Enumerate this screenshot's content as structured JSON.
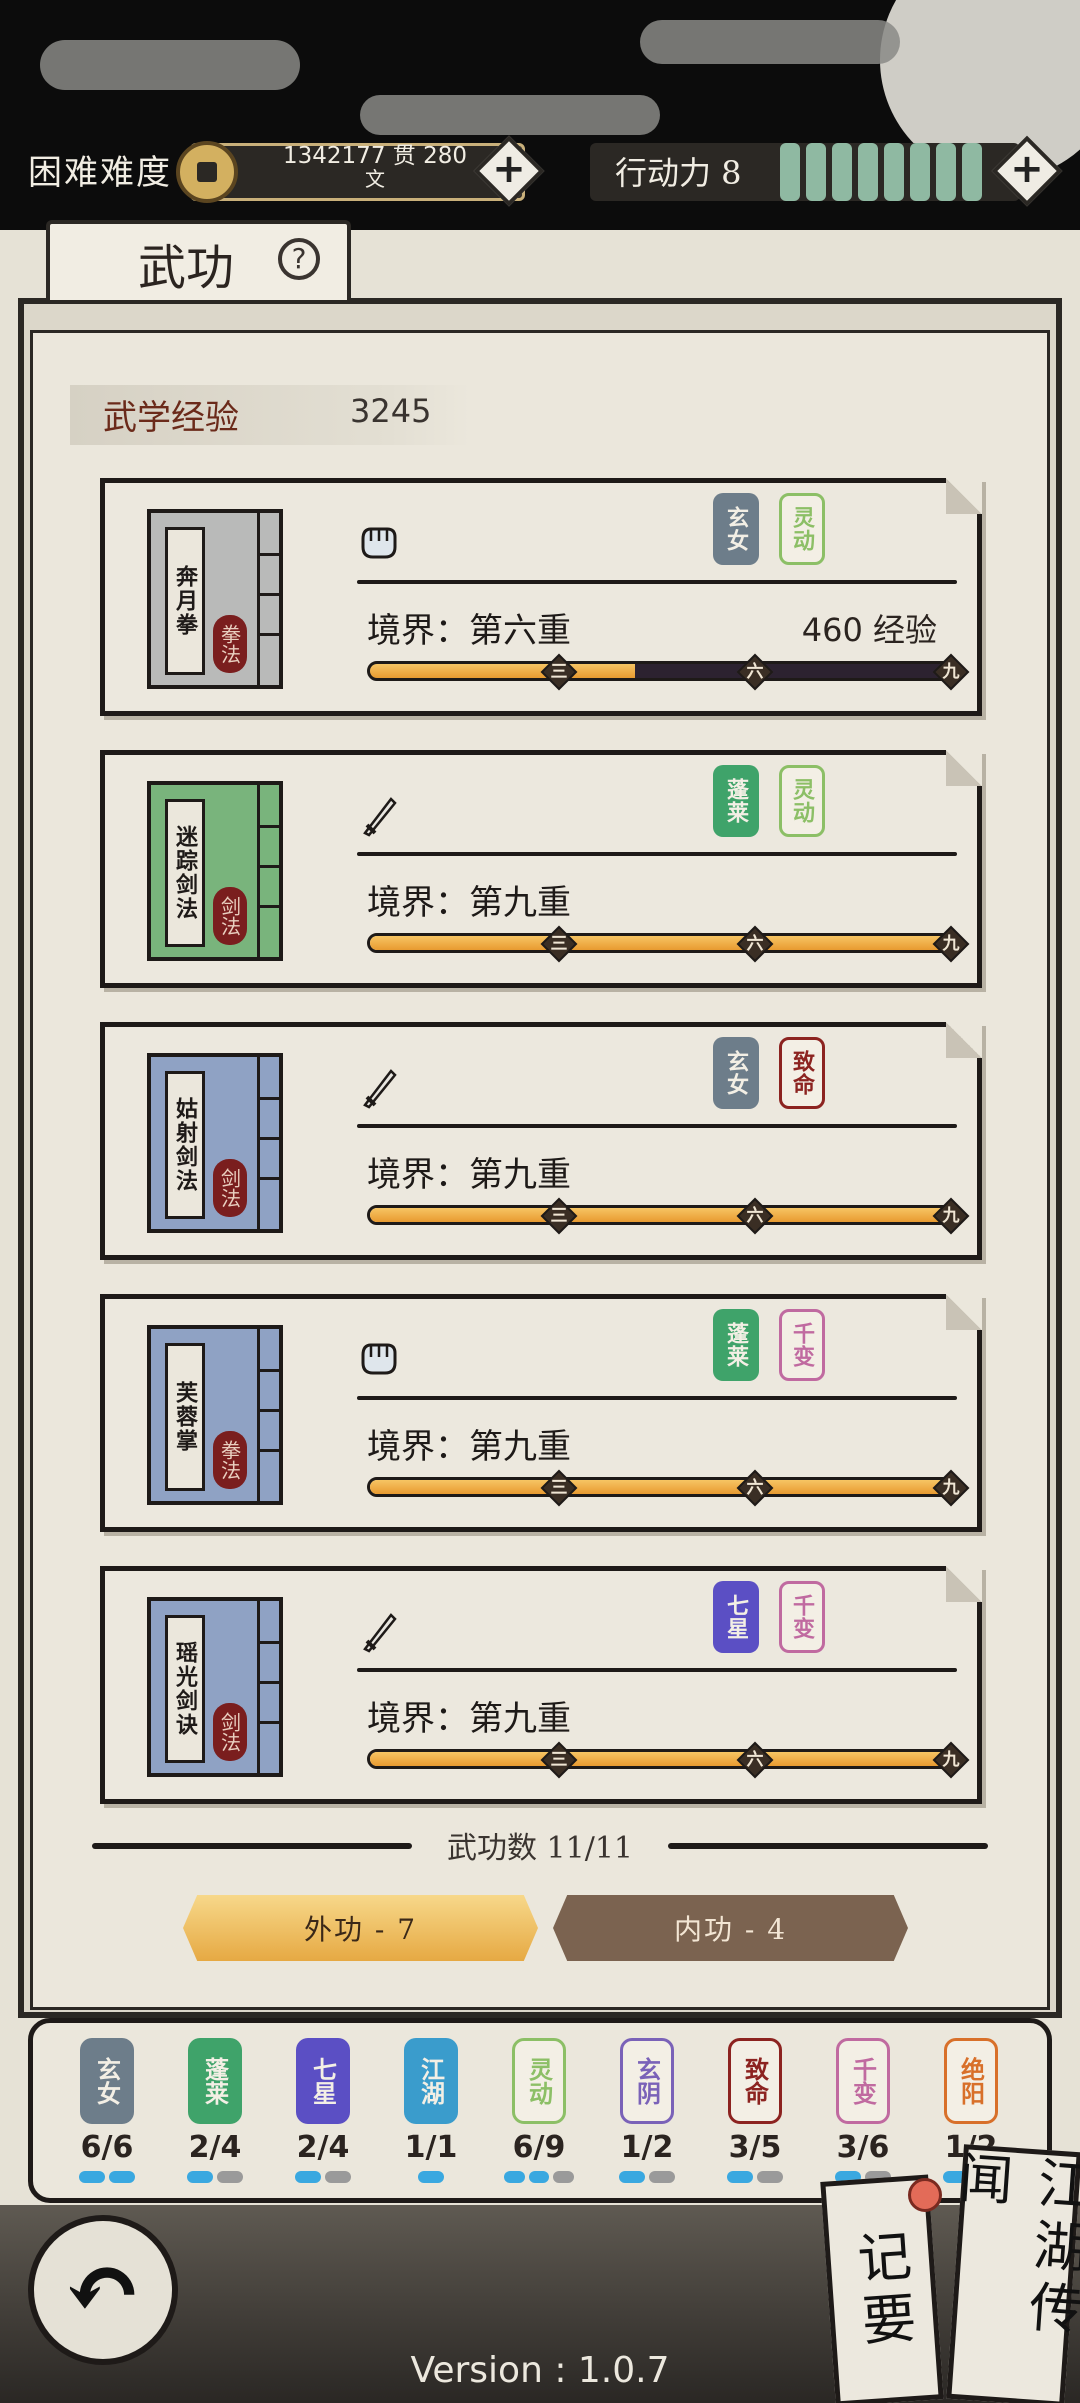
{
  "header": {
    "difficulty": "困难难度",
    "currency_amount": "1342177 贯  280",
    "currency_unit": "文",
    "action_label": "行动力 8",
    "action_pips": 8,
    "add_currency_icon": "plus-icon",
    "add_action_icon": "plus-icon"
  },
  "tab": {
    "title": "武功",
    "help": "?"
  },
  "experience": {
    "label": "武学经验",
    "value": "3245"
  },
  "skills": [
    {
      "name": "奔月拳",
      "category": "拳法",
      "type_icon": "fist-icon",
      "book_color": "#b9bab9",
      "tags": [
        {
          "text": "玄女",
          "color": "#6d7d8a",
          "style": "solid"
        },
        {
          "text": "灵动",
          "color": "#8cbf66",
          "style": "outline"
        }
      ],
      "realm": "境界：第六重",
      "exp_needed": "460 经验",
      "progress": 0.45,
      "markers": [
        "三",
        "六",
        "九"
      ]
    },
    {
      "name": "迷踪剑法",
      "category": "剑法",
      "type_icon": "sword-icon",
      "book_color": "#79b47c",
      "tags": [
        {
          "text": "蓬莱",
          "color": "#3fa36a",
          "style": "solid"
        },
        {
          "text": "灵动",
          "color": "#8cbf66",
          "style": "outline"
        }
      ],
      "realm": "境界：第九重",
      "exp_needed": "",
      "progress": 1.0,
      "markers": [
        "三",
        "六",
        "九"
      ]
    },
    {
      "name": "姑射剑法",
      "category": "剑法",
      "type_icon": "sword-icon",
      "book_color": "#8fa2c4",
      "tags": [
        {
          "text": "玄女",
          "color": "#6d7d8a",
          "style": "solid"
        },
        {
          "text": "致命",
          "color": "#8c2320",
          "style": "outline"
        }
      ],
      "realm": "境界：第九重",
      "exp_needed": "",
      "progress": 1.0,
      "markers": [
        "三",
        "六",
        "九"
      ]
    },
    {
      "name": "芙蓉掌",
      "category": "拳法",
      "type_icon": "fist-icon",
      "book_color": "#8fa2c4",
      "tags": [
        {
          "text": "蓬莱",
          "color": "#3fa36a",
          "style": "solid"
        },
        {
          "text": "千变",
          "color": "#c06aa0",
          "style": "outline"
        }
      ],
      "realm": "境界：第九重",
      "exp_needed": "",
      "progress": 1.0,
      "markers": [
        "三",
        "六",
        "九"
      ]
    },
    {
      "name": "瑶光剑诀",
      "category": "剑法",
      "type_icon": "sword-icon",
      "book_color": "#8fa2c4",
      "tags": [
        {
          "text": "七星",
          "color": "#5b4fc4",
          "style": "solid"
        },
        {
          "text": "千变",
          "color": "#c06aa0",
          "style": "outline"
        }
      ],
      "realm": "境界：第九重",
      "exp_needed": "",
      "progress": 1.0,
      "markers": [
        "三",
        "六",
        "九"
      ]
    }
  ],
  "skill_count": "武功数 11/11",
  "buttons": {
    "external": "外功 - 7",
    "internal": "内功 - 4"
  },
  "sets": [
    {
      "text": "玄女",
      "color": "#6d7d8a",
      "style": "solid",
      "count": "6/6",
      "pips": [
        1,
        1
      ]
    },
    {
      "text": "蓬莱",
      "color": "#3fa36a",
      "style": "solid",
      "count": "2/4",
      "pips": [
        1,
        0
      ]
    },
    {
      "text": "七星",
      "color": "#5b4fc4",
      "style": "solid",
      "count": "2/4",
      "pips": [
        1,
        0
      ]
    },
    {
      "text": "江湖",
      "color": "#3a9ccc",
      "style": "solid",
      "count": "1/1",
      "pips": [
        1
      ]
    },
    {
      "text": "灵动",
      "color": "#8cbf66",
      "style": "outline",
      "count": "6/9",
      "pips": [
        1,
        1,
        0
      ]
    },
    {
      "text": "玄阴",
      "color": "#7a62b8",
      "style": "outline",
      "count": "1/2",
      "pips": [
        1,
        0
      ]
    },
    {
      "text": "致命",
      "color": "#8c2320",
      "style": "outline",
      "count": "3/5",
      "pips": [
        1,
        0
      ]
    },
    {
      "text": "千变",
      "color": "#c06aa0",
      "style": "outline",
      "count": "3/6",
      "pips": [
        1,
        0
      ]
    },
    {
      "text": "绝阳",
      "color": "#d8702a",
      "style": "outline",
      "count": "1/2",
      "pips": [
        1,
        0
      ]
    }
  ],
  "footer": {
    "back_icon": "back-arrow-icon",
    "back_glyph": "↶",
    "notes": "记要",
    "rumors": "江湖传闻",
    "version": "Version : 1.0.7"
  }
}
